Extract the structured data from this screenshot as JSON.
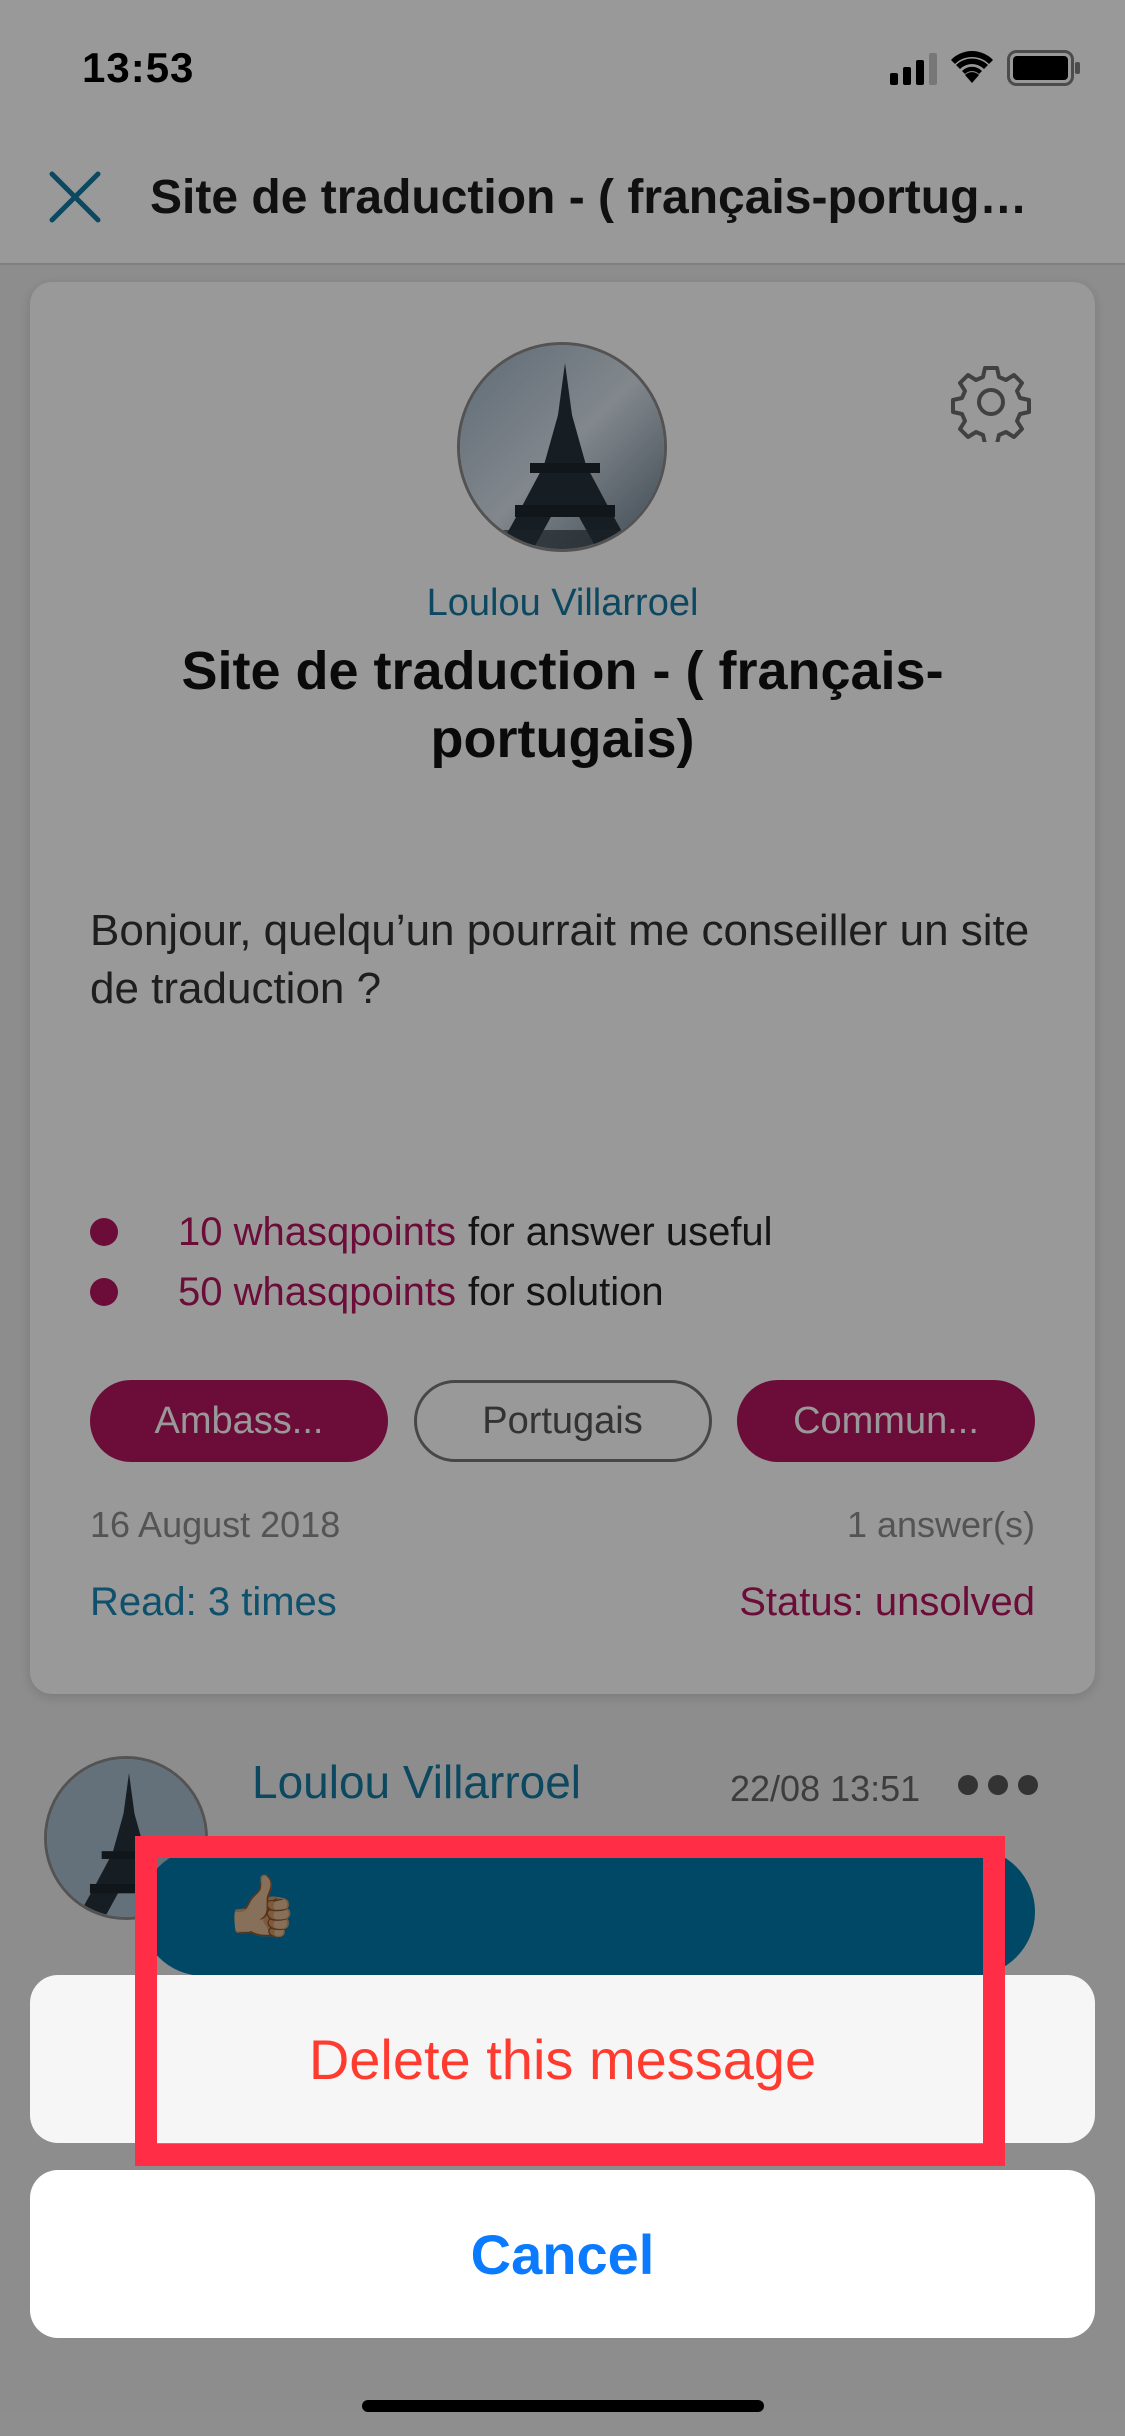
{
  "status_bar": {
    "time": "13:53"
  },
  "nav": {
    "title": "Site de traduction  - ( français-portug…"
  },
  "post": {
    "author": "Loulou Villarroel",
    "title": "Site de traduction  - ( français-portugais)",
    "body": "Bonjour, quelqu’un pourrait me conseiller un site de traduction ?",
    "points": [
      {
        "amount": "10 whasqpoints",
        "label": "for answer useful"
      },
      {
        "amount": "50 whasqpoints",
        "label": "for solution"
      }
    ],
    "tags": [
      "Ambass...",
      "Portugais",
      "Commun..."
    ],
    "date": "16 August 2018",
    "answers": "1 answer(s)",
    "read": "Read: 3 times",
    "status": "Status: unsolved"
  },
  "message": {
    "author": "Loulou Villarroel",
    "time": "22/08 13:51",
    "content": "👍🏼"
  },
  "action_sheet": {
    "delete_label": "Delete this message",
    "cancel_label": "Cancel"
  },
  "colors": {
    "accent_blue": "#1479a1",
    "accent_magenta": "#b5155f",
    "destructive": "#ff3b30",
    "ios_blue": "#0a7aff",
    "highlight": "#ff2d46"
  }
}
